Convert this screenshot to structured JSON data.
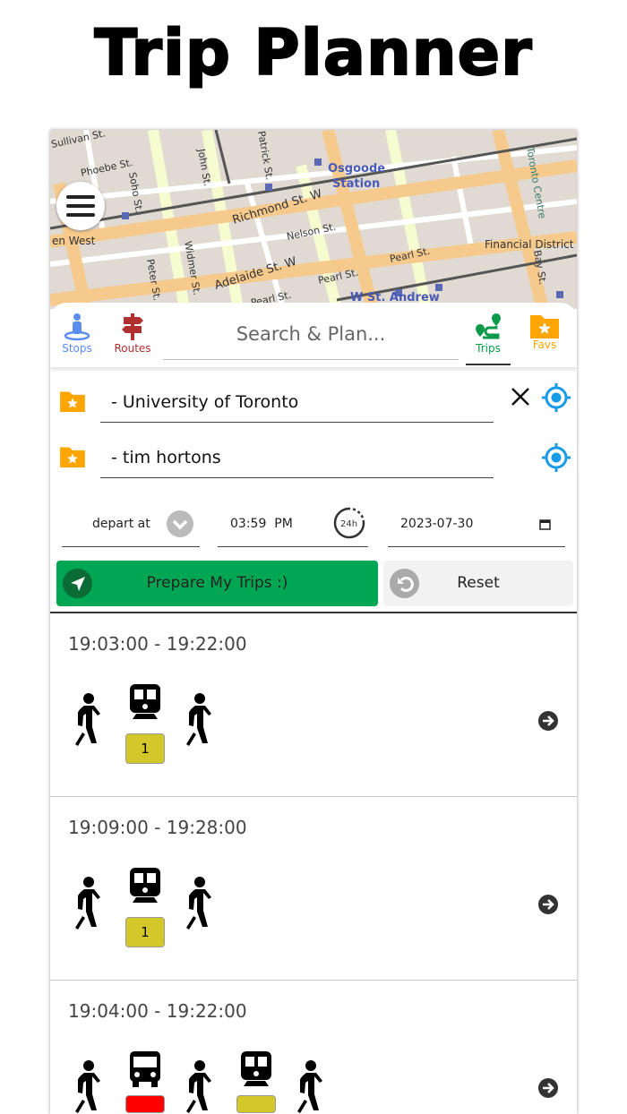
{
  "page_title": "Trip Planner",
  "map": {
    "labels": [
      "Phoebe St.",
      "Soho St.",
      "John St.",
      "Osgoode",
      "Station",
      "Richmond St. W",
      "Nelson St.",
      "Widmer St.",
      "Peter St.",
      "Adelaide St. W",
      "Pearl St.",
      "Pearl St.",
      "Pearl St.",
      "W St. Andrew",
      "Financial District",
      "Toronto Centre",
      "Bay St.",
      "en West",
      "Patrick St.",
      "Sullivan St."
    ]
  },
  "nav": {
    "stops": "Stops",
    "routes": "Routes",
    "search_placeholder": "Search & Plan...",
    "trips": "Trips",
    "favs": "Favs"
  },
  "from": {
    "value": "- University of Toronto"
  },
  "to": {
    "value": "- tim hortons"
  },
  "options": {
    "mode": "depart at",
    "time": "03:59  PM",
    "clock_label": "24h",
    "date": "2023-07-30"
  },
  "buttons": {
    "prepare": "Prepare My Trips :)",
    "reset": "Reset"
  },
  "colors": {
    "accent_green": "#00a651",
    "stops_blue": "#5b8def",
    "routes_red": "#b03030",
    "favs_orange": "#ffa500",
    "location_blue": "#1a9be6",
    "subway_yellow": "#d4c72a",
    "bus_red": "#ff0000"
  },
  "trips": [
    {
      "time": "19:03:00 - 19:22:00",
      "legs": [
        {
          "mode": "walk"
        },
        {
          "mode": "subway",
          "route": "1"
        },
        {
          "mode": "walk"
        }
      ]
    },
    {
      "time": "19:09:00 - 19:28:00",
      "legs": [
        {
          "mode": "walk"
        },
        {
          "mode": "subway",
          "route": "1"
        },
        {
          "mode": "walk"
        }
      ]
    },
    {
      "time": "19:04:00 - 19:22:00",
      "legs": [
        {
          "mode": "walk"
        },
        {
          "mode": "bus",
          "route": ""
        },
        {
          "mode": "walk"
        },
        {
          "mode": "subway",
          "route": ""
        },
        {
          "mode": "walk"
        }
      ]
    }
  ]
}
